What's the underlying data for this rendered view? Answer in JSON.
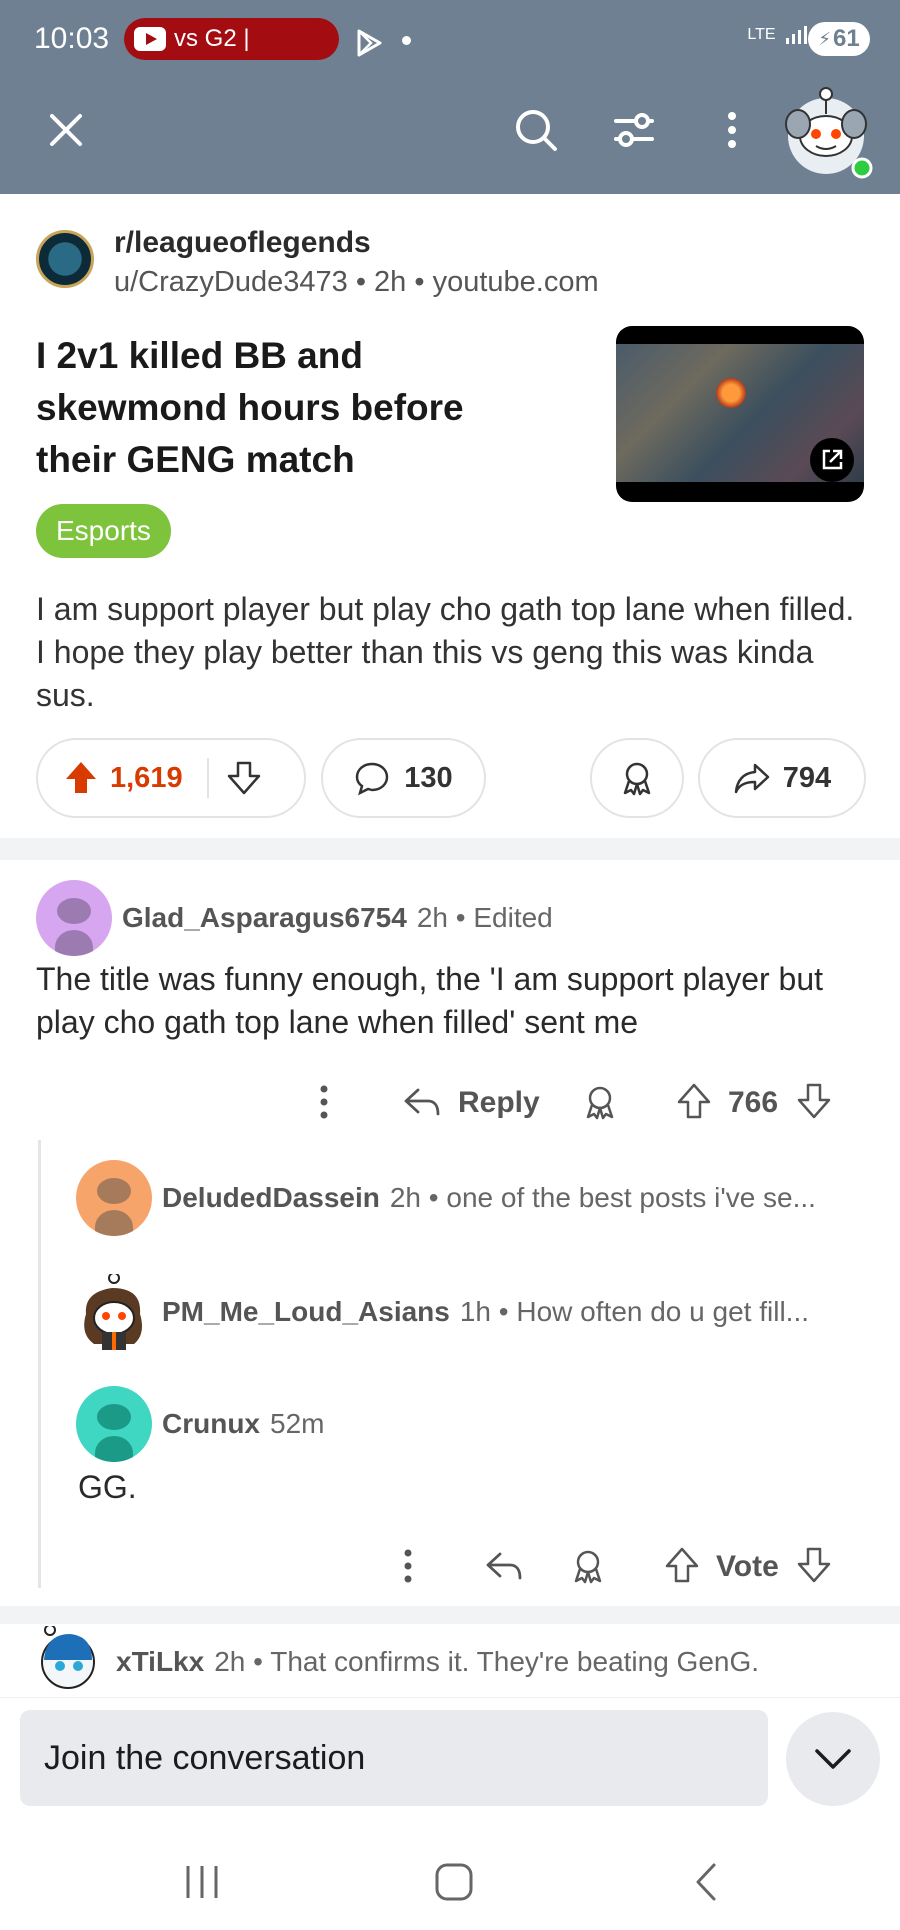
{
  "status_bar": {
    "time": "10:03",
    "media_pill": "vs G2 |",
    "network": "LTE",
    "battery": "61"
  },
  "toolbar": {
    "close_icon": "close-icon",
    "search_icon": "search-icon",
    "filter_icon": "filter-icon",
    "more_icon": "more-vertical-icon"
  },
  "post": {
    "subreddit": "r/leagueoflegends",
    "author": "u/CrazyDude3473",
    "age": "2h",
    "domain": "youtube.com",
    "title": "I 2v1 killed BB and skewmond hours before their GENG match",
    "flair": "Esports",
    "body": "I am support player but play cho gath top lane when filled. I hope they play better than this vs geng this was kinda sus.",
    "upvotes": "1,619",
    "comments": "130",
    "shares": "794"
  },
  "comments": [
    {
      "user": "Glad_Asparagus6754",
      "age": "2h",
      "meta": "Edited",
      "text": "The title was funny enough, the 'I am support player but play cho gath top lane when filled' sent me",
      "reply_label": "Reply",
      "votes": "766",
      "avatar_color": "#d7a6f0"
    }
  ],
  "replies": [
    {
      "user": "DeludedDassein",
      "age": "2h",
      "preview": "one of the best posts i've se...",
      "avatar_color": "#f7a46a"
    },
    {
      "user": "PM_Me_Loud_Asians",
      "age": "1h",
      "preview": "How often do u get fill...",
      "avatar_color": "#ffffff"
    },
    {
      "user": "Crunux",
      "age": "52m",
      "text": "GG.",
      "vote_label": "Vote",
      "avatar_color": "#3fd6c2"
    }
  ],
  "next_comment": {
    "user": "xTiLkx",
    "age": "2h",
    "preview": "That confirms it. They're beating GenG."
  },
  "composer": {
    "placeholder": "Join the conversation"
  },
  "colors": {
    "header": "#6e8092",
    "upvote": "#d93a00",
    "flair": "#7dc33c"
  }
}
